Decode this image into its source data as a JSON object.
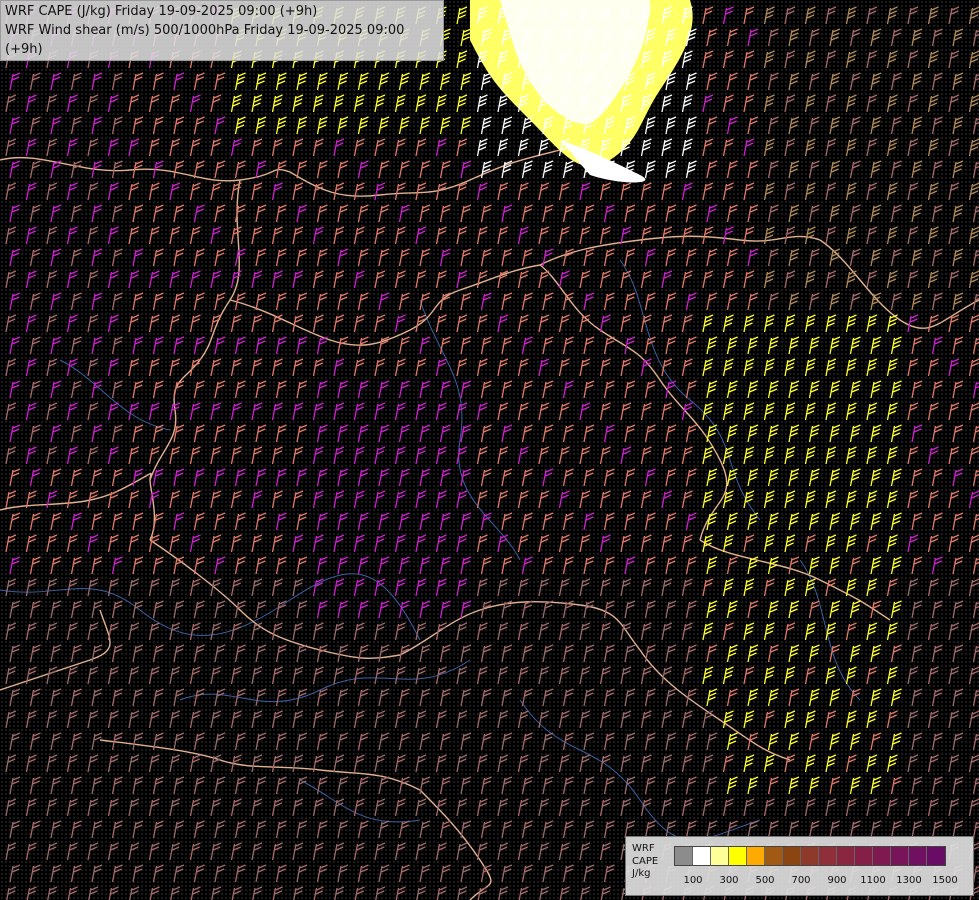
{
  "header": {
    "line1": "WRF CAPE (J/kg) Friday 19-09-2025 09:00 (+9h)",
    "line2": "WRF Wind shear (m/s) 500/1000hPa Friday 19-09-2025 09:00 (+9h)"
  },
  "legend": {
    "caption": [
      "WRF",
      "CAPE",
      "J/kg"
    ],
    "colors": [
      "#8c8c8c",
      "#ffffff",
      "#ffff99",
      "#ffff00",
      "#ffaa00",
      "#a05a14",
      "#8b4513",
      "#8e3a2a",
      "#8e2f3a",
      "#8b2640",
      "#861f48",
      "#7f1a50",
      "#781458",
      "#701060",
      "#680c66"
    ],
    "ticks": [
      "100",
      "300",
      "500",
      "700",
      "900",
      "1100",
      "1300",
      "1500"
    ]
  },
  "map": {
    "barb_colors": {
      "magenta": "#cc22cc",
      "yellow": "#ffff33",
      "salmon": "#e07a6a",
      "rose": "#a86a6a",
      "tan": "#b08a5a",
      "white": "#ffffff"
    },
    "border_color": "#e0b090",
    "river_color": "#3a5fa0"
  }
}
